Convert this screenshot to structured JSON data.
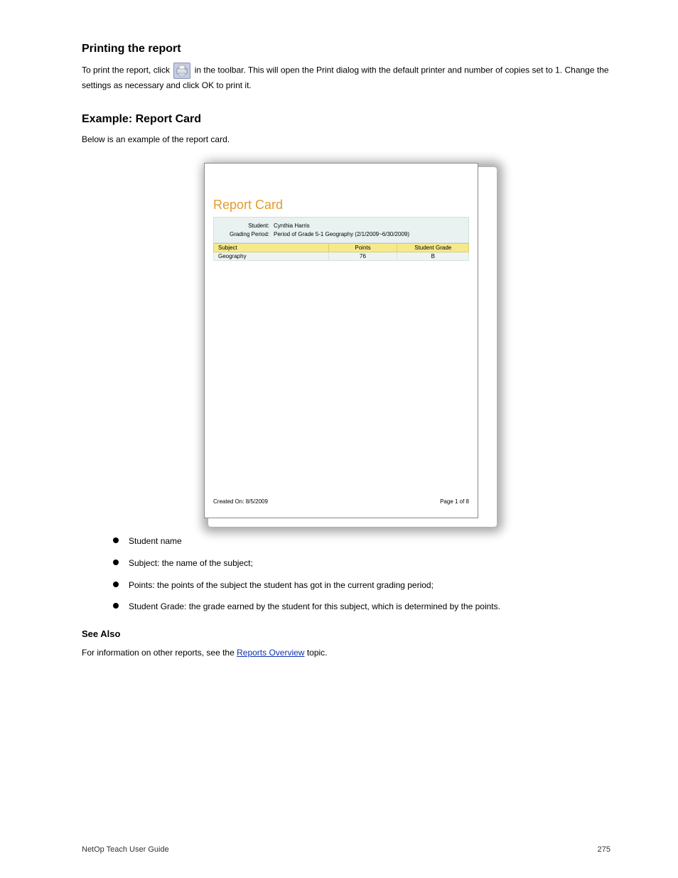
{
  "heading_print": "Printing the report",
  "print_paragraph_pre": "To print the report, click ",
  "print_paragraph_post": " in the toolbar. This will open the Print dialog with the default printer and number of copies set to 1. Change the settings as necessary and click OK to print it.",
  "heading_example": "Example: Report Card",
  "example_intro": "Below is an example of the report card.",
  "report": {
    "title": "Report Card",
    "info": {
      "student_label": "Student:",
      "student_value": "Cynthia Harris",
      "period_label": "Grading Period:",
      "period_value": "Period of Grade 5-1 Geography (2/1/2009~6/30/2009)"
    },
    "columns": {
      "subject": "Subject",
      "points": "Points",
      "grade": "Student Grade"
    },
    "rows": [
      {
        "subject": "Geography",
        "points": "76",
        "grade": "B"
      }
    ],
    "footer": {
      "created": "Created On: 8/5/2009",
      "page": "Page 1 of 8"
    }
  },
  "bullets": [
    "Student name",
    "Subject: the name of the subject;",
    "Points: the points of the subject the student has got in the current grading period;",
    "Student Grade: the grade earned by the student for this subject, which is determined by the points."
  ],
  "heading_seealso": "See Also",
  "seealso_pre": "For information on other reports, see the ",
  "seealso_link": "Reports Overview",
  "seealso_post": " topic.",
  "footer": {
    "left": "NetOp Teach User Guide",
    "right": "275"
  }
}
